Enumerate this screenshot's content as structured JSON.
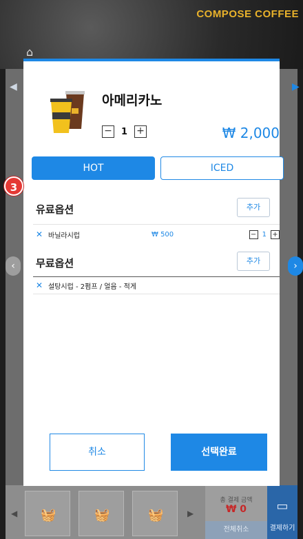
{
  "background": {
    "brand_text": "COMPOSE COFFEE",
    "cart_total_label": "총 결제 금액",
    "cart_total_amount": "₩ 0",
    "cancel_all_label": "전체취소",
    "pay_label": "결제하기"
  },
  "modal": {
    "product_name": "아메리카노",
    "quantity": "1",
    "price": "₩ 2,000",
    "tabs": [
      {
        "label": "HOT",
        "active": true
      },
      {
        "label": "ICED",
        "active": false
      }
    ],
    "paid_options": {
      "title": "유료옵션",
      "add_label": "추가",
      "items": [
        {
          "name": "바닐라시럽",
          "price": "₩ 500",
          "qty": "1"
        }
      ]
    },
    "free_options": {
      "title": "무료옵션",
      "add_label": "추가",
      "items": [
        {
          "name": "설탕시럽 - 2펌프 / 얼음 - 적게"
        }
      ]
    },
    "cancel_label": "취소",
    "confirm_label": "선택완료"
  },
  "step_badge": "3",
  "colors": {
    "accent": "#1e88e5",
    "badge": "#e53935",
    "brand": "#e9b22b"
  }
}
